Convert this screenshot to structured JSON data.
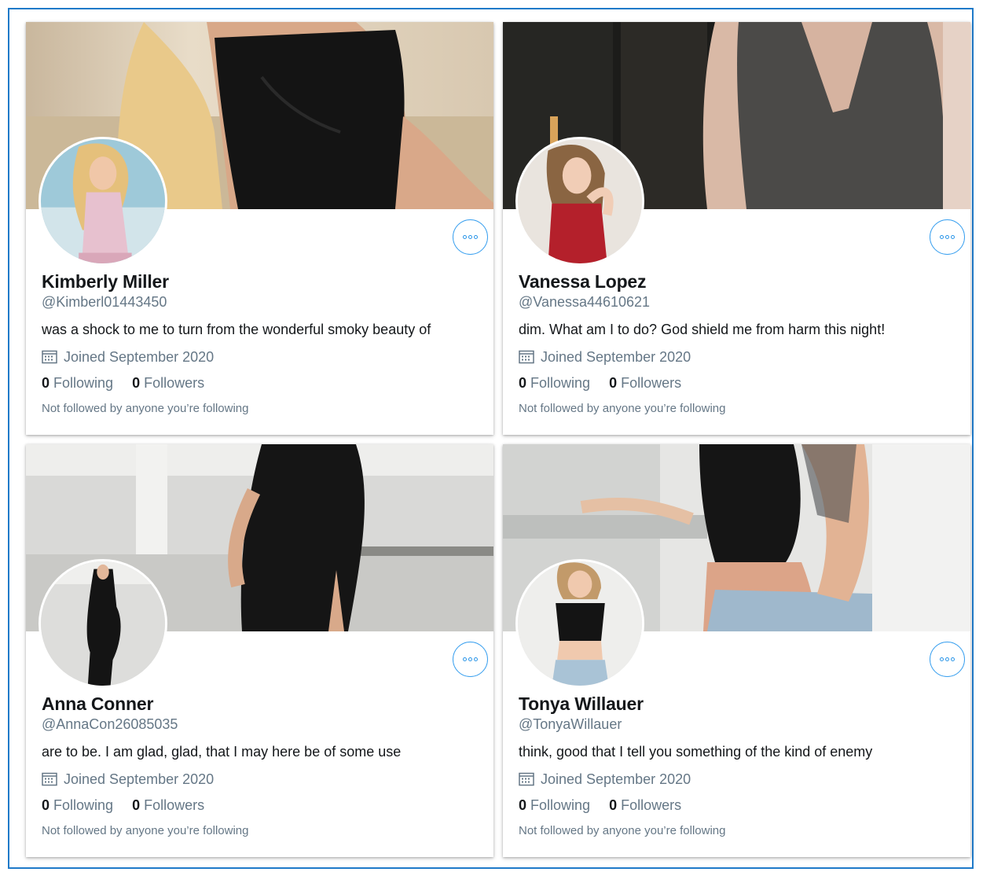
{
  "cards": [
    {
      "name": "Kimberly Miller",
      "handle": "@Kimberl01443450",
      "bio": "was a shock to me to turn from the wonderful smoky beauty of",
      "joined": "Joined September 2020",
      "following_count": "0",
      "following_label": "Following",
      "followers_count": "0",
      "followers_label": "Followers",
      "not_followed": "Not followed by anyone you’re following",
      "banner_image": "woman-black-dress-banner",
      "avatar_image": "blonde-woman-pink-top-avatar"
    },
    {
      "name": "Vanessa Lopez",
      "handle": "@Vanessa44610621",
      "bio": "dim. What am I to do? God shield me from harm this night!",
      "joined": "Joined September 2020",
      "following_count": "0",
      "following_label": "Following",
      "followers_count": "0",
      "followers_label": "Followers",
      "not_followed": "Not followed by anyone you’re following",
      "banner_image": "woman-grey-top-banner",
      "avatar_image": "woman-red-dress-avatar"
    },
    {
      "name": "Anna Conner",
      "handle": "@AnnaCon26085035",
      "bio": "are to be. I am glad, glad, that I may here be of some use",
      "joined": "Joined September 2020",
      "following_count": "0",
      "following_label": "Following",
      "followers_count": "0",
      "followers_label": "Followers",
      "not_followed": "Not followed by anyone you’re following",
      "banner_image": "woman-black-dress-kitchen-banner",
      "avatar_image": "woman-black-dress-avatar"
    },
    {
      "name": "Tonya Willauer",
      "handle": "@TonyaWillauer",
      "bio": "think, good that I tell you something of the kind of enemy",
      "joined": "Joined September 2020",
      "following_count": "0",
      "following_label": "Following",
      "followers_count": "0",
      "followers_label": "Followers",
      "not_followed": "Not followed by anyone you’re following",
      "banner_image": "woman-tattoo-crop-top-banner",
      "avatar_image": "woman-black-crop-top-avatar"
    }
  ],
  "colors": {
    "accent": "#1DA1F2",
    "text_primary": "#14171A",
    "text_secondary": "#657786",
    "frame_border": "#1F7AC9"
  }
}
